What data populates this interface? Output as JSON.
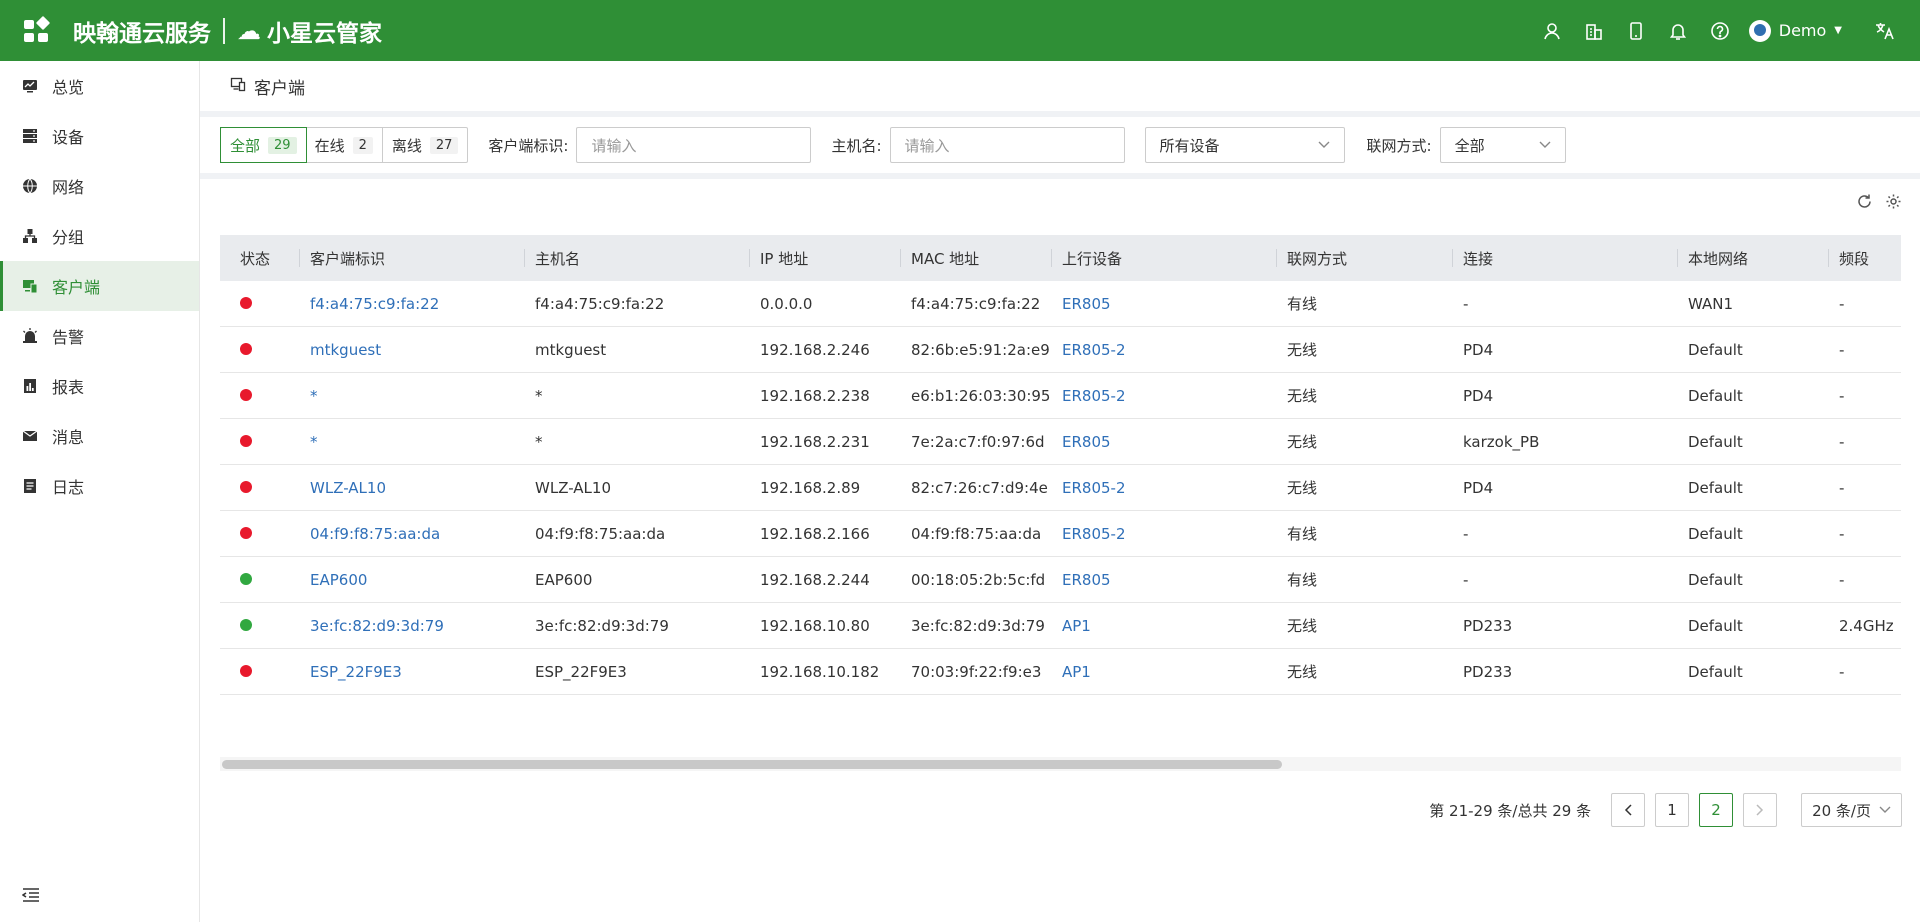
{
  "header": {
    "brand_left": "映翰通云服务",
    "brand_right": "小星云管家",
    "user_name": "Demo",
    "bg_color": "#2f8f36"
  },
  "sidebar": {
    "items": [
      {
        "label": "总览",
        "icon": "monitor-icon"
      },
      {
        "label": "设备",
        "icon": "device-icon"
      },
      {
        "label": "网络",
        "icon": "globe-icon"
      },
      {
        "label": "分组",
        "icon": "group-icon"
      },
      {
        "label": "客户端",
        "icon": "client-icon",
        "active": true
      },
      {
        "label": "告警",
        "icon": "alarm-icon"
      },
      {
        "label": "报表",
        "icon": "report-icon"
      },
      {
        "label": "消息",
        "icon": "mail-icon"
      },
      {
        "label": "日志",
        "icon": "log-icon"
      }
    ]
  },
  "page": {
    "title": "客户端"
  },
  "filters": {
    "status_tabs": [
      {
        "label": "全部",
        "count": "29"
      },
      {
        "label": "在线",
        "count": "2"
      },
      {
        "label": "离线",
        "count": "27"
      }
    ],
    "client_id_label": "客户端标识:",
    "client_id_placeholder": "请输入",
    "hostname_label": "主机名:",
    "hostname_placeholder": "请输入",
    "device_select": "所有设备",
    "net_mode_label": "联网方式:",
    "net_mode_select": "全部"
  },
  "table": {
    "columns": [
      "状态",
      "客户端标识",
      "主机名",
      "IP 地址",
      "MAC 地址",
      "上行设备",
      "联网方式",
      "连接",
      "本地网络",
      "频段"
    ],
    "rows": [
      {
        "status": "offline",
        "id": "f4:a4:75:c9:fa:22",
        "host": "f4:a4:75:c9:fa:22",
        "ip": "0.0.0.0",
        "mac": "f4:a4:75:c9:fa:22",
        "uplink": "ER805",
        "mode": "有线",
        "conn": "-",
        "lan": "WAN1",
        "band": "-"
      },
      {
        "status": "offline",
        "id": "mtkguest",
        "host": "mtkguest",
        "ip": "192.168.2.246",
        "mac": "82:6b:e5:91:2a:e9",
        "uplink": "ER805-2",
        "mode": "无线",
        "conn": "PD4",
        "lan": "Default",
        "band": "-"
      },
      {
        "status": "offline",
        "id": "*",
        "host": "*",
        "ip": "192.168.2.238",
        "mac": "e6:b1:26:03:30:95",
        "uplink": "ER805-2",
        "mode": "无线",
        "conn": "PD4",
        "lan": "Default",
        "band": "-"
      },
      {
        "status": "offline",
        "id": "*",
        "host": "*",
        "ip": "192.168.2.231",
        "mac": "7e:2a:c7:f0:97:6d",
        "uplink": "ER805",
        "mode": "无线",
        "conn": "karzok_PB",
        "lan": "Default",
        "band": "-"
      },
      {
        "status": "offline",
        "id": "WLZ-AL10",
        "host": "WLZ-AL10",
        "ip": "192.168.2.89",
        "mac": "82:c7:26:c7:d9:4e",
        "uplink": "ER805-2",
        "mode": "无线",
        "conn": "PD4",
        "lan": "Default",
        "band": "-"
      },
      {
        "status": "offline",
        "id": "04:f9:f8:75:aa:da",
        "host": "04:f9:f8:75:aa:da",
        "ip": "192.168.2.166",
        "mac": "04:f9:f8:75:aa:da",
        "uplink": "ER805-2",
        "mode": "有线",
        "conn": "-",
        "lan": "Default",
        "band": "-"
      },
      {
        "status": "online",
        "id": "EAP600",
        "host": "EAP600",
        "ip": "192.168.2.244",
        "mac": "00:18:05:2b:5c:fd",
        "uplink": "ER805",
        "mode": "有线",
        "conn": "-",
        "lan": "Default",
        "band": "-"
      },
      {
        "status": "online",
        "id": "3e:fc:82:d9:3d:79",
        "host": "3e:fc:82:d9:3d:79",
        "ip": "192.168.10.80",
        "mac": "3e:fc:82:d9:3d:79",
        "uplink": "AP1",
        "mode": "无线",
        "conn": "PD233",
        "lan": "Default",
        "band": "2.4GHz"
      },
      {
        "status": "offline",
        "id": "ESP_22F9E3",
        "host": "ESP_22F9E3",
        "ip": "192.168.10.182",
        "mac": "70:03:9f:22:f9:e3",
        "uplink": "AP1",
        "mode": "无线",
        "conn": "PD233",
        "lan": "Default",
        "band": "-"
      }
    ]
  },
  "pagination": {
    "summary": "第 21-29 条/总共 29 条",
    "pages": [
      "1",
      "2"
    ],
    "current": "2",
    "page_size": "20 条/页"
  }
}
